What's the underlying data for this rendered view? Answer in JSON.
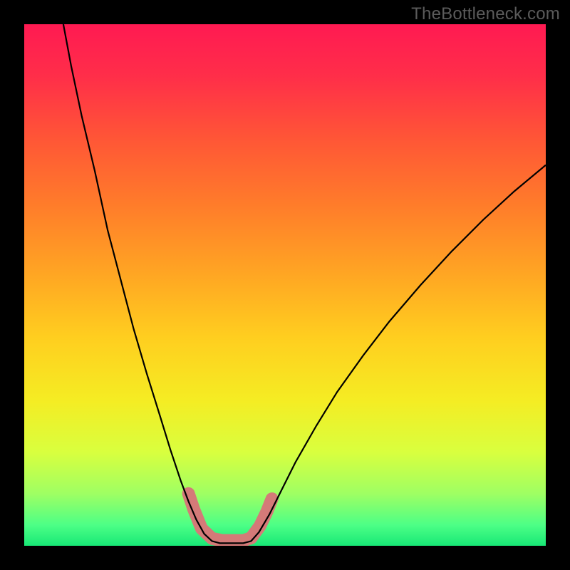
{
  "watermark": "TheBottleneck.com",
  "chart_data": {
    "type": "line",
    "title": "",
    "xlabel": "",
    "ylabel": "",
    "xlim": [
      0,
      100
    ],
    "ylim": [
      0,
      100
    ],
    "gradient_stops": [
      {
        "offset": 0.0,
        "color": "#ff1a52"
      },
      {
        "offset": 0.1,
        "color": "#ff2e49"
      },
      {
        "offset": 0.22,
        "color": "#ff5636"
      },
      {
        "offset": 0.35,
        "color": "#ff7d2a"
      },
      {
        "offset": 0.48,
        "color": "#ffa623"
      },
      {
        "offset": 0.6,
        "color": "#ffce1f"
      },
      {
        "offset": 0.72,
        "color": "#f5ec23"
      },
      {
        "offset": 0.82,
        "color": "#d9ff3e"
      },
      {
        "offset": 0.9,
        "color": "#9fff63"
      },
      {
        "offset": 0.96,
        "color": "#4dff86"
      },
      {
        "offset": 1.0,
        "color": "#18e876"
      }
    ],
    "series": [
      {
        "name": "curve",
        "stroke": "#000000",
        "stroke_width": 2.2,
        "points": [
          {
            "x": 7.5,
            "y": 100.0
          },
          {
            "x": 9.0,
            "y": 92.0
          },
          {
            "x": 11.0,
            "y": 82.5
          },
          {
            "x": 13.5,
            "y": 72.0
          },
          {
            "x": 16.0,
            "y": 60.5
          },
          {
            "x": 18.5,
            "y": 51.0
          },
          {
            "x": 21.0,
            "y": 41.5
          },
          {
            "x": 23.5,
            "y": 33.0
          },
          {
            "x": 26.0,
            "y": 25.0
          },
          {
            "x": 28.0,
            "y": 18.5
          },
          {
            "x": 30.0,
            "y": 12.5
          },
          {
            "x": 31.5,
            "y": 8.5
          },
          {
            "x": 33.0,
            "y": 5.0
          },
          {
            "x": 34.5,
            "y": 2.3
          },
          {
            "x": 36.0,
            "y": 0.9
          },
          {
            "x": 37.5,
            "y": 0.5
          },
          {
            "x": 39.0,
            "y": 0.5
          },
          {
            "x": 40.5,
            "y": 0.5
          },
          {
            "x": 42.0,
            "y": 0.5
          },
          {
            "x": 43.5,
            "y": 0.9
          },
          {
            "x": 45.0,
            "y": 2.6
          },
          {
            "x": 47.0,
            "y": 6.0
          },
          {
            "x": 49.0,
            "y": 10.0
          },
          {
            "x": 52.0,
            "y": 16.0
          },
          {
            "x": 56.0,
            "y": 23.0
          },
          {
            "x": 60.0,
            "y": 29.5
          },
          {
            "x": 65.0,
            "y": 36.5
          },
          {
            "x": 70.0,
            "y": 43.0
          },
          {
            "x": 76.0,
            "y": 50.0
          },
          {
            "x": 82.0,
            "y": 56.5
          },
          {
            "x": 88.0,
            "y": 62.5
          },
          {
            "x": 94.0,
            "y": 68.0
          },
          {
            "x": 100.0,
            "y": 73.0
          }
        ]
      },
      {
        "name": "highlight-band",
        "stroke": "#d47a78",
        "stroke_width": 18,
        "linecap": "round",
        "points": [
          {
            "x": 31.5,
            "y": 10.0
          },
          {
            "x": 32.5,
            "y": 7.0
          },
          {
            "x": 34.0,
            "y": 3.3
          },
          {
            "x": 36.0,
            "y": 1.4
          },
          {
            "x": 38.0,
            "y": 1.0
          },
          {
            "x": 40.0,
            "y": 1.0
          },
          {
            "x": 42.0,
            "y": 1.0
          },
          {
            "x": 43.5,
            "y": 1.5
          },
          {
            "x": 45.2,
            "y": 3.8
          },
          {
            "x": 46.5,
            "y": 6.5
          },
          {
            "x": 47.5,
            "y": 9.0
          }
        ]
      }
    ]
  }
}
